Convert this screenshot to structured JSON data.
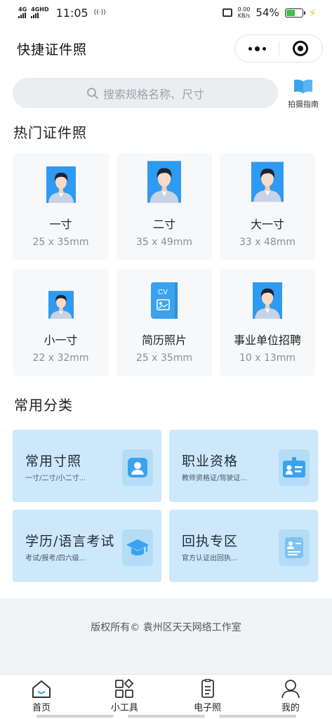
{
  "status_bar": {
    "net1": "4G",
    "net2": "4GHD",
    "time": "11:05",
    "speed_value": "0.00",
    "speed_unit": "KB/s",
    "battery": "54%",
    "battery_level": 0.54
  },
  "nav": {
    "title": "快捷证件照"
  },
  "search": {
    "placeholder": "搜索规格名称、尺寸"
  },
  "guide": {
    "label": "拍摄指南"
  },
  "hot": {
    "title": "热门证件照",
    "items": [
      {
        "name": "一寸",
        "size": "25 x 35mm"
      },
      {
        "name": "二寸",
        "size": "35 x 49mm"
      },
      {
        "name": "大一寸",
        "size": "33 x 48mm"
      },
      {
        "name": "小一寸",
        "size": "22 x 32mm"
      },
      {
        "name": "简历照片",
        "size": "25 x 35mm"
      },
      {
        "name": "事业单位招聘",
        "size": "10 x 13mm"
      }
    ]
  },
  "categories": {
    "title": "常用分类",
    "items": [
      {
        "title": "常用寸照",
        "sub": "一寸/二寸/小二寸..."
      },
      {
        "title": "职业资格",
        "sub": "教师资格证/驾驶证..."
      },
      {
        "title": "学历/语言考试",
        "sub": "考试/报考/四六级..."
      },
      {
        "title": "回执专区",
        "sub": "官方认证出回执..."
      }
    ]
  },
  "cv_label": "CV",
  "footer": {
    "copyright": "版权所有© 袁州区天天网络工作室"
  },
  "tabbar": {
    "items": [
      {
        "label": "首页"
      },
      {
        "label": "小工具"
      },
      {
        "label": "电子照"
      },
      {
        "label": "我的"
      }
    ]
  },
  "colors": {
    "photo_bg": "#2f9af2",
    "category_bg": "#cde8fb",
    "icon_blue": "#3aa2ee"
  }
}
